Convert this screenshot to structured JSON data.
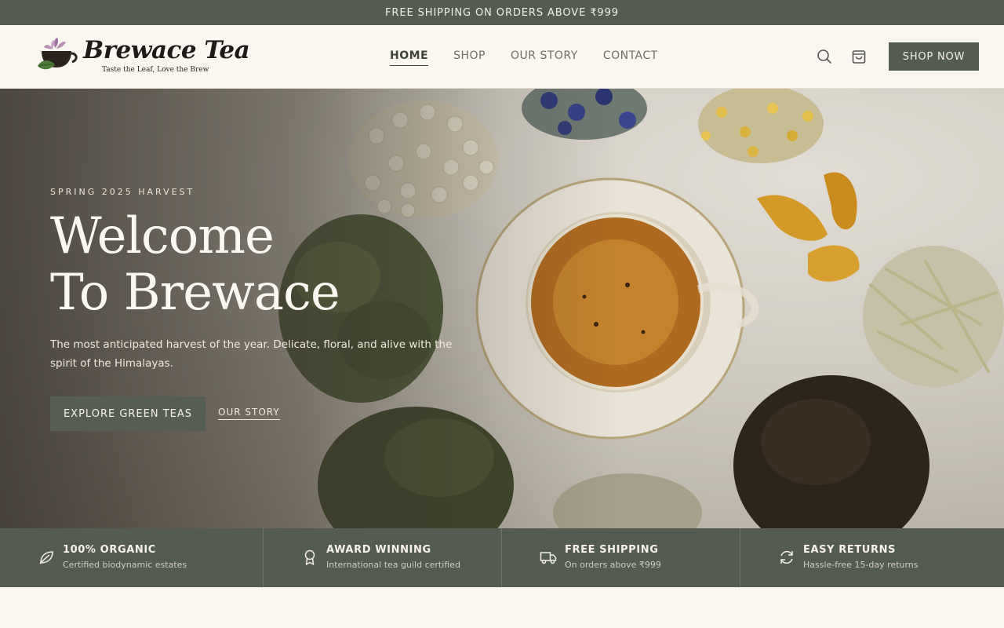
{
  "announcement": "FREE SHIPPING ON ORDERS ABOVE ₹999",
  "brand": {
    "name": "Brewace Tea",
    "tagline": "Taste the Leaf, Love the Brew"
  },
  "nav": {
    "items": [
      {
        "label": "HOME",
        "active": true
      },
      {
        "label": "SHOP",
        "active": false
      },
      {
        "label": "OUR STORY",
        "active": false
      },
      {
        "label": "CONTACT",
        "active": false
      }
    ]
  },
  "header_actions": {
    "search_icon": "search-icon",
    "cart_icon": "shopping-bag-icon",
    "shop_now_label": "SHOP NOW"
  },
  "hero": {
    "eyebrow": "SPRING 2025 HARVEST",
    "title_line1": "Welcome",
    "title_line2": "To Brewace",
    "subtitle": "The most anticipated harvest of the year. Delicate, floral, and alive with the spirit of the Himalayas.",
    "primary_cta": "EXPLORE GREEN TEAS",
    "secondary_cta": "OUR STORY"
  },
  "features": [
    {
      "icon": "leaf-icon",
      "title": "100% ORGANIC",
      "subtitle": "Certified biodynamic estates"
    },
    {
      "icon": "award-icon",
      "title": "AWARD WINNING",
      "subtitle": "International tea guild certified"
    },
    {
      "icon": "truck-icon",
      "title": "FREE SHIPPING",
      "subtitle": "On orders above ₹999"
    },
    {
      "icon": "refresh-icon",
      "title": "EASY RETURNS",
      "subtitle": "Hassle-free 15-day returns"
    }
  ],
  "colors": {
    "primary": "#545b51",
    "background": "#faf7f1",
    "accent_text": "#3e443c"
  }
}
